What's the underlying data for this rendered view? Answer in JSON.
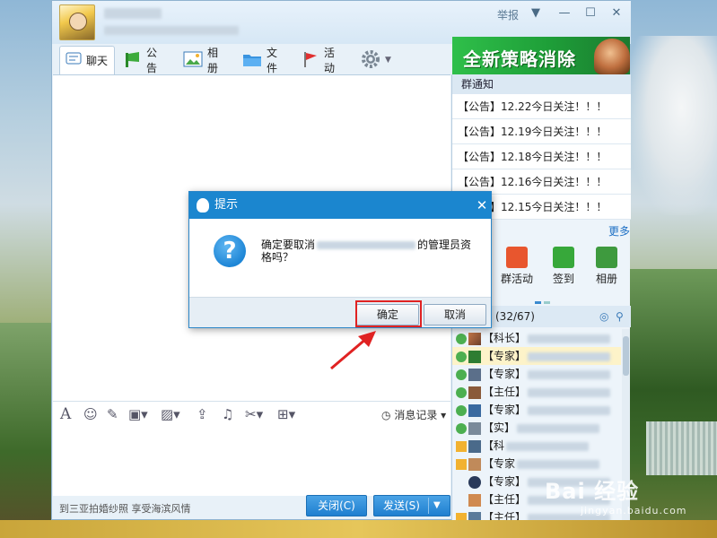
{
  "window": {
    "report": "举报",
    "tabs": [
      {
        "label": "聊天",
        "icon": "chat-icon"
      },
      {
        "label": "公告",
        "icon": "announcement-icon"
      },
      {
        "label": "相册",
        "icon": "album-icon"
      },
      {
        "label": "文件",
        "icon": "folder-icon"
      },
      {
        "label": "活动",
        "icon": "flag-icon"
      }
    ],
    "ad_text": "全新策略消除"
  },
  "side": {
    "notice_title": "群通知",
    "notices": [
      "【公告】12.22今日关注！！！",
      "【公告】12.19今日关注！！！",
      "【公告】12.18今日关注！！！",
      "【公告】12.16今日关注！！！",
      "【公告】12.15今日关注！！！"
    ],
    "more": "更多",
    "apps": [
      {
        "label": "群活动",
        "icon": "group-activity-icon"
      },
      {
        "label": "签到",
        "icon": "checkin-icon"
      },
      {
        "label": "相册",
        "icon": "album-icon"
      }
    ],
    "member_count": "(32/67)",
    "members": [
      "【科长】",
      "【专家】",
      "【专家】",
      "【主任】",
      "【专家】",
      "【实】",
      "【科",
      "【专家",
      "【专家】",
      "【主任】",
      "【主任】"
    ]
  },
  "chat": {
    "history": "消息记录",
    "promo": "到三亚拍婚纱照 享受海滨风情",
    "close": "关闭(C)",
    "send": "发送(S)"
  },
  "dialog": {
    "title": "提示",
    "message_prefix": "确定要取消",
    "message_suffix": "的管理员资格吗？",
    "ok": "确定",
    "cancel": "取消"
  },
  "watermark": {
    "main": "Bai 经验",
    "sub": "jingyan.baidu.com"
  },
  "colors": {
    "accent": "#1b86cf",
    "highlight": "#e02222"
  }
}
